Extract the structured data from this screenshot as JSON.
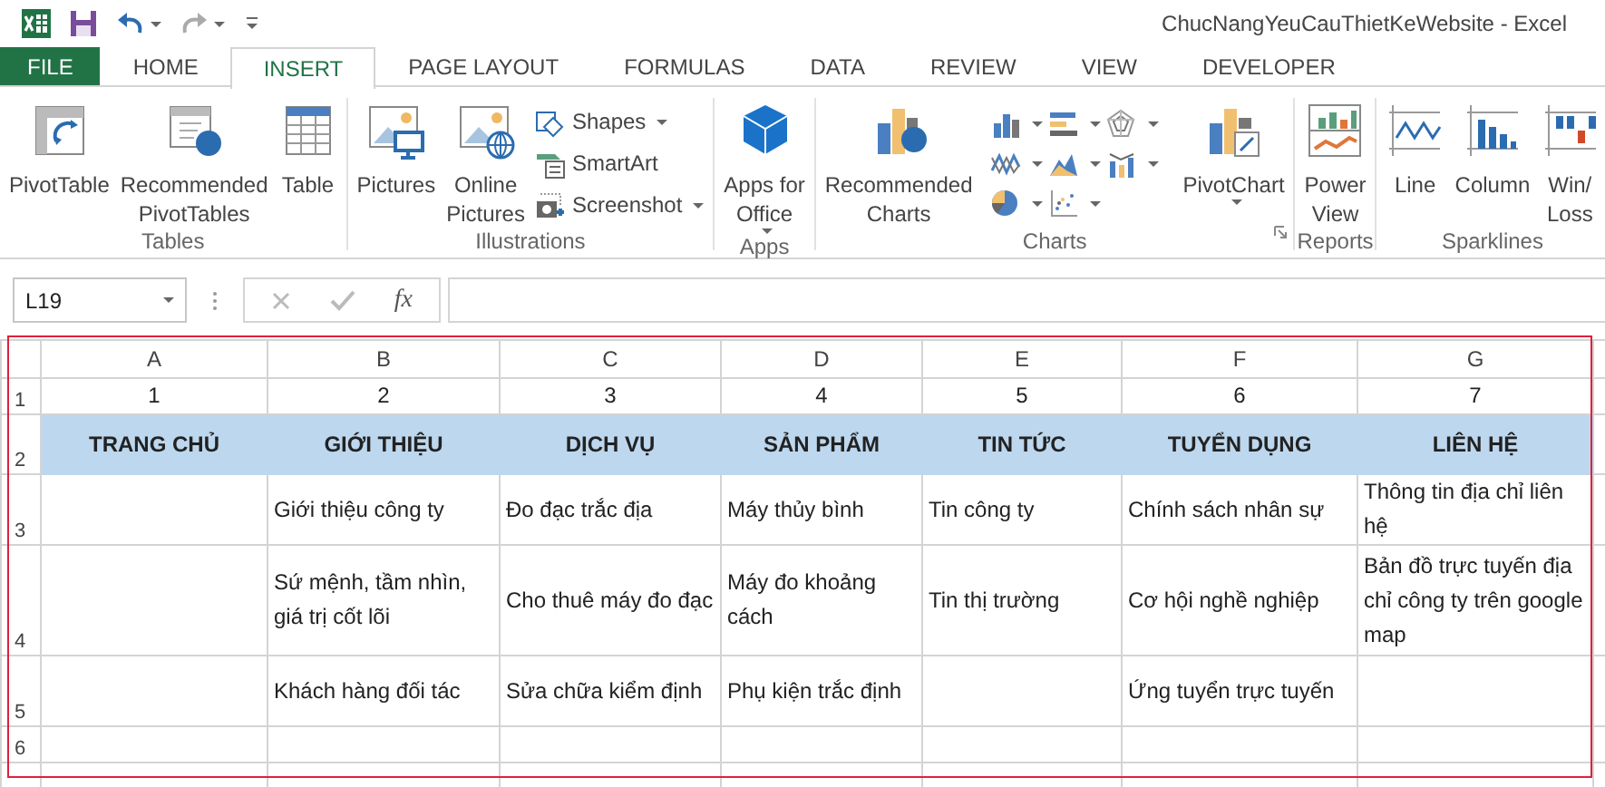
{
  "window": {
    "title": "ChucNangYeuCauThietKeWebsite - Excel"
  },
  "tabs": [
    {
      "label": "FILE",
      "kind": "file",
      "selected": false
    },
    {
      "label": "HOME",
      "kind": "tab",
      "selected": false
    },
    {
      "label": "INSERT",
      "kind": "tab",
      "selected": true
    },
    {
      "label": "PAGE LAYOUT",
      "kind": "tab",
      "selected": false
    },
    {
      "label": "FORMULAS",
      "kind": "tab",
      "selected": false
    },
    {
      "label": "DATA",
      "kind": "tab",
      "selected": false
    },
    {
      "label": "REVIEW",
      "kind": "tab",
      "selected": false
    },
    {
      "label": "VIEW",
      "kind": "tab",
      "selected": false
    },
    {
      "label": "DEVELOPER",
      "kind": "tab",
      "selected": false
    }
  ],
  "ribbon": [
    {
      "label": "Tables",
      "items": [
        {
          "kind": "large",
          "label": "PivotTable",
          "dropdown": false
        },
        {
          "kind": "large",
          "label": "Recommended\nPivotTables",
          "dropdown": false
        },
        {
          "kind": "large",
          "label": "Table",
          "dropdown": false
        }
      ]
    },
    {
      "label": "Illustrations",
      "items": [
        {
          "kind": "large",
          "label": "Pictures",
          "dropdown": false
        },
        {
          "kind": "large",
          "label": "Online\nPictures",
          "dropdown": false
        },
        {
          "kind": "stack",
          "items": [
            {
              "label": "Shapes",
              "dropdown": true
            },
            {
              "label": "SmartArt",
              "dropdown": false
            },
            {
              "label": "Screenshot",
              "dropdown": true
            }
          ]
        }
      ]
    },
    {
      "label": "Apps",
      "items": [
        {
          "kind": "large",
          "label": "Apps for\nOffice",
          "dropdown": true
        }
      ]
    },
    {
      "label": "Charts",
      "launcher": true,
      "items": [
        {
          "kind": "large",
          "label": "Recommended\nCharts",
          "dropdown": false
        },
        {
          "kind": "gallery"
        },
        {
          "kind": "large",
          "label": "PivotChart",
          "dropdown": true
        }
      ]
    },
    {
      "label": "Reports",
      "items": [
        {
          "kind": "large",
          "label": "Power\nView",
          "dropdown": false
        }
      ]
    },
    {
      "label": "Sparklines",
      "items": [
        {
          "kind": "large",
          "label": "Line",
          "dropdown": false
        },
        {
          "kind": "large",
          "label": "Column",
          "dropdown": false
        },
        {
          "kind": "large",
          "label": "Win/\nLoss",
          "dropdown": false
        }
      ]
    }
  ],
  "formula_bar": {
    "name_box": "L19",
    "function_label": "fx"
  },
  "sheet": {
    "columns": [
      "A",
      "B",
      "C",
      "D",
      "E",
      "F",
      "G"
    ],
    "rows": [
      {
        "header": "1",
        "kind": "number",
        "cells": [
          "1",
          "2",
          "3",
          "4",
          "5",
          "6",
          "7"
        ]
      },
      {
        "header": "2",
        "kind": "heading",
        "cells": [
          "TRANG CHỦ",
          "GIỚI THIỆU",
          "DỊCH VỤ",
          "SẢN PHẨM",
          "TIN TỨC",
          "TUYỂN DỤNG",
          "LIÊN HỆ"
        ]
      },
      {
        "header": "3",
        "kind": "text",
        "cells": [
          null,
          "Giới thiệu công ty",
          "Đo đạc trắc địa",
          "Máy thủy bình",
          "Tin công ty",
          "Chính sách nhân sự",
          "Thông tin địa chỉ liên hệ"
        ]
      },
      {
        "header": "4",
        "kind": "text",
        "cells": [
          null,
          "Sứ mệnh, tầm nhìn, giá trị cốt lõi",
          "Cho thuê máy đo đạc",
          "Máy đo khoảng cách",
          "Tin thị trường",
          "Cơ hội nghề nghiệp",
          "Bản đồ trực tuyến địa chỉ công ty trên google map"
        ]
      },
      {
        "header": "5",
        "kind": "text",
        "cells": [
          null,
          "Khách hàng đối tác",
          "Sửa chữa kiểm định",
          "Phụ kiện trắc định",
          null,
          "Ứng tuyển trực tuyến",
          null
        ]
      },
      {
        "header": "6",
        "kind": "text"
      }
    ]
  }
}
